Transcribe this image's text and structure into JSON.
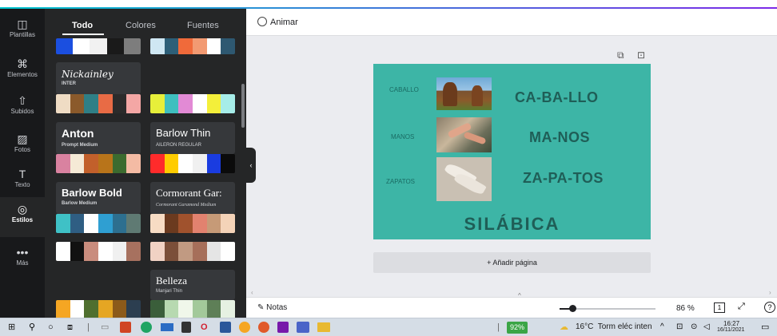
{
  "rail": {
    "items": [
      {
        "label": "Plantillas",
        "icon": "template-icon",
        "glyph": "◫"
      },
      {
        "label": "Elementos",
        "icon": "elements-icon",
        "glyph": "⌘"
      },
      {
        "label": "Subidos",
        "icon": "upload-icon",
        "glyph": "⇧"
      },
      {
        "label": "Fotos",
        "icon": "photo-icon",
        "glyph": "▨"
      },
      {
        "label": "Texto",
        "icon": "text-icon",
        "glyph": "T"
      },
      {
        "label": "Estilos",
        "icon": "styles-icon",
        "glyph": "◎"
      },
      {
        "label": "Más",
        "icon": "more-icon",
        "glyph": "•••"
      }
    ]
  },
  "panel": {
    "tabs": [
      "Todo",
      "Colores",
      "Fuentes"
    ],
    "fonts": [
      {
        "title": "Nickainley",
        "sub": "INTER"
      },
      {
        "title": "Anton",
        "sub": "Prompt Medium"
      },
      {
        "title": "Barlow Thin",
        "sub": "AILERON REGULAR"
      },
      {
        "title": "Barlow Bold",
        "sub": "Barlow Medium"
      },
      {
        "title": "Cormorant Gar:",
        "sub": "Cormorant Garamond Medium"
      },
      {
        "title": "Belleza",
        "sub": "Manjari Thin"
      }
    ],
    "palettes": [
      [
        "#1b4fe0",
        "#ffffff",
        "#f1f1f1",
        "#1a1a1a",
        "#7d7d7d"
      ],
      [
        "#cfe7f3",
        "#2d5f78",
        "#f06a3a",
        "#f29a72",
        "#ffffff",
        "#2e5871"
      ],
      [
        "#efdcc4",
        "#8b5a2b",
        "#2f7f86",
        "#e86b45",
        "#2b2b2b",
        "#f4a7a5"
      ],
      [
        "#e7ef3a",
        "#3fbfbf",
        "#e28ad5",
        "#ffffff",
        "#f4ef3a",
        "#a6ede9"
      ],
      [
        "#d982a0",
        "#f5ead6",
        "#c2602b",
        "#b8741a",
        "#3b6b2f",
        "#f4bba4"
      ],
      [
        "#ff2b2b",
        "#ffcc00",
        "#ffffff",
        "#f0f0f0",
        "#1a3ce0",
        "#0b0b0b"
      ],
      [
        "#3fc1c6",
        "#2f5e83",
        "#ffffff",
        "#2f9fd2",
        "#2d6f8f",
        "#5f7a73"
      ],
      [
        "#f7dcc4",
        "#6b3a1f",
        "#a0522d",
        "#e2826f",
        "#c69a77",
        "#f4d3b8"
      ],
      [
        "#ffffff",
        "#111111",
        "#c98c7d",
        "#ffffff",
        "#f0f0f0",
        "#a7715f"
      ],
      [
        "#f1d2c4",
        "#7b4f39",
        "#c19a82",
        "#a66f5a",
        "#e5e5e5",
        "#ffffff"
      ],
      [
        "#f5a623",
        "#ffffff",
        "#4f6f2f",
        "#e5a623",
        "#8c5a1a",
        "#2c3e50"
      ],
      [
        "#3a5e3a",
        "#b7d9b0",
        "#f0f7ea",
        "#a3c99a",
        "#5e7f57",
        "#e6f1e2"
      ]
    ]
  },
  "header": {
    "animate_label": "Animar"
  },
  "slide": {
    "rows": [
      {
        "word": "CABALLO",
        "syllables": "CA-BA-LLO"
      },
      {
        "word": "MANOS",
        "syllables": "MA-NOS"
      },
      {
        "word": "ZAPATOS",
        "syllables": "ZA-PA-TOS"
      }
    ],
    "title": "SILÁBICA",
    "bg_color": "#3db5a6"
  },
  "add_page_label": "+ Añadir página",
  "footer": {
    "notes_label": "Notas",
    "zoom": "86 %",
    "page_number": "1",
    "help": "?"
  },
  "taskbar": {
    "battery": "92%",
    "weather": "16°C  Torm eléc inten",
    "time": "16:27",
    "date": "16/11/2021"
  }
}
